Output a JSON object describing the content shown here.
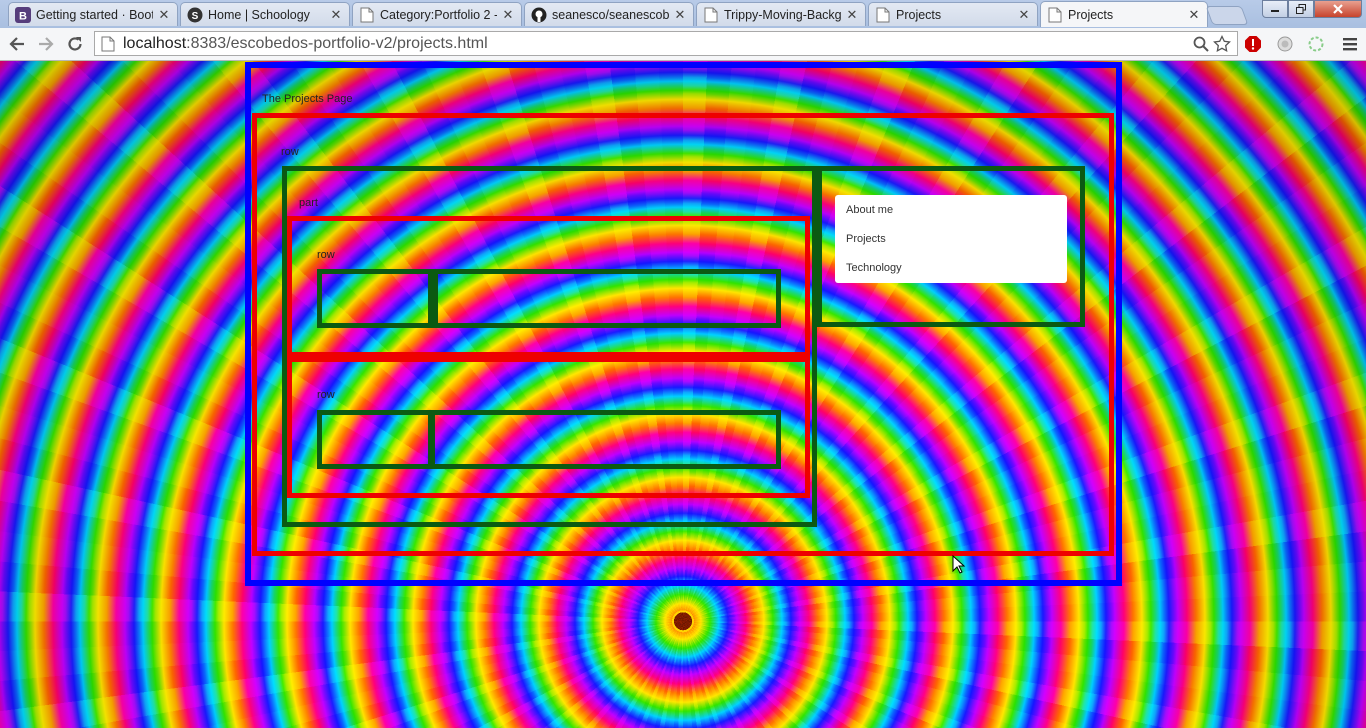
{
  "browser": {
    "tabs": [
      {
        "label": "Getting started · Boots",
        "favicon": "bootstrap-icon"
      },
      {
        "label": "Home | Schoology",
        "favicon": "schoology-icon"
      },
      {
        "label": "Category:Portfolio 2 -",
        "favicon": "page-icon"
      },
      {
        "label": "seanesco/seanescobe",
        "favicon": "github-icon"
      },
      {
        "label": "Trippy-Moving-Backg",
        "favicon": "page-icon"
      },
      {
        "label": "Projects",
        "favicon": "page-icon"
      },
      {
        "label": "Projects",
        "favicon": "page-icon",
        "active": true
      }
    ],
    "url": {
      "host": "localhost",
      "path": ":8383/escobedos-portfolio-v2/projects.html"
    }
  },
  "page": {
    "title_label": "The Projects Page",
    "outer_row_label": "row",
    "part_label": "part",
    "inner_row1_label": "row",
    "inner_row2_label": "row",
    "nav": {
      "items": [
        "About me",
        "Projects",
        "Technology"
      ]
    }
  },
  "colors": {
    "container_border": "#0000ff",
    "row_border": "#ee0000",
    "column_border": "#0b5a12"
  }
}
